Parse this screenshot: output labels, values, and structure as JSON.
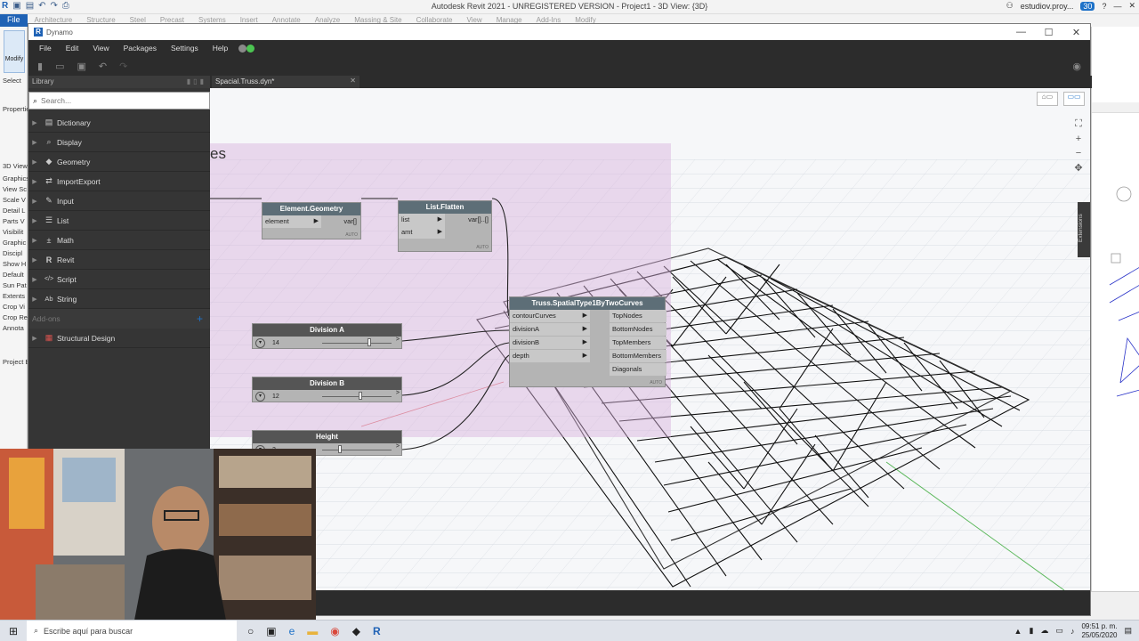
{
  "revit": {
    "window_title": "Autodesk Revit 2021 - UNREGISTERED VERSION - Project1 - 3D View: {3D}",
    "user": "estudiov.proy...",
    "badge_count": "30",
    "file_tab": "File",
    "ribbon_tabs": [
      "Architecture",
      "Structure",
      "Steel",
      "Precast",
      "Systems",
      "Insert",
      "Annotate",
      "Analyze",
      "Massing & Site",
      "Collaborate",
      "View",
      "Manage",
      "Add-Ins",
      "Modify"
    ],
    "modify_label": "Modify",
    "select_label": "Select",
    "properties_label": "Properties",
    "left_labels": [
      "3D View",
      "Graphics",
      "View Sc",
      "Scale V",
      "Detail L",
      "Parts V",
      "Visibilit",
      "Graphic",
      "Discipl",
      "Show H",
      "Default",
      "Sun Pat",
      "Extents",
      "Crop Vi",
      "Crop Re",
      "Annota",
      "Project B"
    ]
  },
  "dynamo": {
    "window_title": "Dynamo",
    "menu": [
      "File",
      "Edit",
      "View",
      "Packages",
      "Settings",
      "Help"
    ],
    "status_colors": [
      "#8a8a8a",
      "#4cc552"
    ],
    "toolbar_icons": [
      "new-icon",
      "open-icon",
      "save-icon",
      "undo-icon",
      "redo-icon"
    ],
    "library": {
      "title": "Library",
      "search_placeholder": "Search...",
      "items": [
        {
          "label": "Dictionary",
          "icon": "dictionary-icon",
          "glyph": "▤"
        },
        {
          "label": "Display",
          "icon": "magnifier-icon",
          "glyph": "⌕"
        },
        {
          "label": "Geometry",
          "icon": "cube-icon",
          "glyph": "◆"
        },
        {
          "label": "ImportExport",
          "icon": "import-export-icon",
          "glyph": "⇄"
        },
        {
          "label": "Input",
          "icon": "pencil-icon",
          "glyph": "✎"
        },
        {
          "label": "List",
          "icon": "list-icon",
          "glyph": "☰"
        },
        {
          "label": "Math",
          "icon": "math-icon",
          "glyph": "±"
        },
        {
          "label": "Revit",
          "icon": "revit-icon",
          "glyph": "R"
        },
        {
          "label": "Script",
          "icon": "script-icon",
          "glyph": "</>"
        },
        {
          "label": "String",
          "icon": "string-icon",
          "glyph": "Ab"
        }
      ],
      "addons_label": "Add-ons",
      "addon_items": [
        {
          "label": "Structural Design",
          "icon": "structural-design-icon",
          "glyph": "▦"
        }
      ]
    },
    "tab_label": "Spacial.Truss.dyn*",
    "group_title": "es",
    "extensions_label": "Extensions",
    "nodes": {
      "element_geometry": {
        "title": "Element.Geometry",
        "input": "element",
        "output": "var[]",
        "lacing": "AUTO"
      },
      "list_flatten": {
        "title": "List.Flatten",
        "inputs": [
          "list",
          "amt"
        ],
        "output": "var[]..[]",
        "lacing": "AUTO"
      },
      "truss": {
        "title": "Truss.SpatialType1ByTwoCurves",
        "inputs": [
          "contourCurves",
          "divisionA",
          "divisionB",
          "depth"
        ],
        "outputs": [
          "TopNodes",
          "BottomNodes",
          "TopMembers",
          "BottomMembers",
          "Diagonals"
        ],
        "lacing": "AUTO"
      },
      "sliders": [
        {
          "title": "Division A",
          "value": "14",
          "position": 0.68
        },
        {
          "title": "Division B",
          "value": "12",
          "position": 0.55
        },
        {
          "title": "Height",
          "value": "2",
          "position": 0.25
        }
      ]
    }
  },
  "taskbar": {
    "search_placeholder": "Escribe aquí para buscar",
    "time": "09:51 p. m.",
    "date": "25/05/2020"
  }
}
